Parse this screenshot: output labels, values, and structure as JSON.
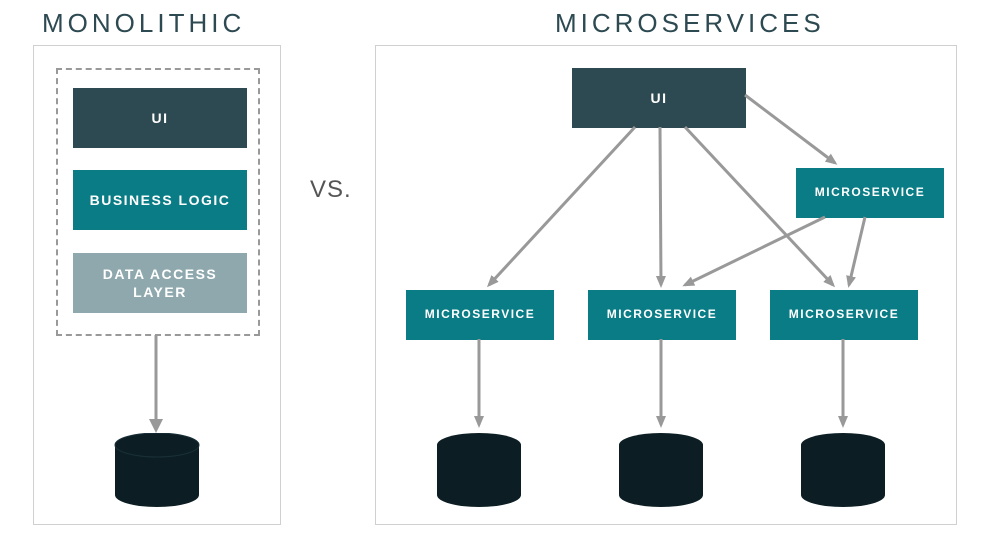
{
  "titles": {
    "monolithic": "MONOLITHIC",
    "microservices": "MICROSERVICES"
  },
  "vs_label": "VS.",
  "monolithic": {
    "ui_label": "UI",
    "business_logic_label": "BUSINESS LOGIC",
    "data_access_label": "DATA ACCESS LAYER"
  },
  "microservices": {
    "ui_label": "UI",
    "ms_label": "MICROSERVICE"
  },
  "colors": {
    "dark": "#2d4a52",
    "teal": "#0a7c85",
    "light": "#8fa8ae",
    "db": "#0c1e24",
    "arrow": "#999999",
    "border": "#d0d0d0"
  }
}
